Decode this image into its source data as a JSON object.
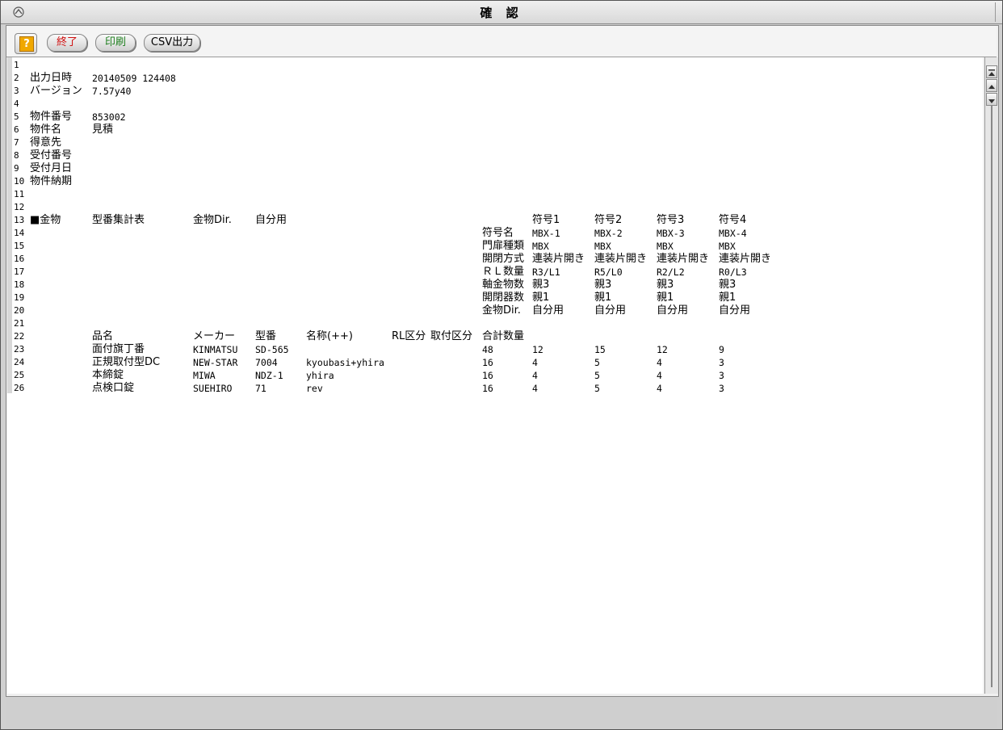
{
  "window": {
    "title": "確 認"
  },
  "toolbar": {
    "help_label": "?",
    "exit_label": "終了",
    "print_label": "印刷",
    "csv_label": "CSV出力",
    "exit_color": "#d01010",
    "print_color": "#208020"
  },
  "report": {
    "line_numbers": [
      "1",
      "2",
      "3",
      "4",
      "5",
      "6",
      "7",
      "8",
      "9",
      "10",
      "11",
      "12",
      "13",
      "14",
      "15",
      "16",
      "17",
      "18",
      "19",
      "20",
      "21",
      "22",
      "23",
      "24",
      "25",
      "26"
    ],
    "header": {
      "output_datetime_label": "出力日時",
      "output_datetime_value": "20140509 124408",
      "version_label": "バージョン",
      "version_value": "7.57y40",
      "property_no_label": "物件番号",
      "property_no_value": "853002",
      "property_name_label": "物件名",
      "property_name_value": "見積",
      "customer_label": "得意先",
      "reception_no_label": "受付番号",
      "reception_date_label": "受付月日",
      "delivery_label": "物件納期"
    },
    "section": {
      "hardware_label": "■金物",
      "model_summary_label": "型番集計表",
      "hardware_dir_label": "金物Dir.",
      "hardware_dir_value": "自分用"
    },
    "symbols": {
      "row_labels": [
        "符号名",
        "門扉種類",
        "開閉方式",
        "ＲＬ数量",
        "軸金物数",
        "開閉器数",
        "金物Dir."
      ],
      "columns": [
        {
          "header": "符号1",
          "values": [
            "MBX-1",
            "MBX",
            "連装片開き",
            "R3/L1",
            "親3",
            "親1",
            "自分用"
          ]
        },
        {
          "header": "符号2",
          "values": [
            "MBX-2",
            "MBX",
            "連装片開き",
            "R5/L0",
            "親3",
            "親1",
            "自分用"
          ]
        },
        {
          "header": "符号3",
          "values": [
            "MBX-3",
            "MBX",
            "連装片開き",
            "R2/L2",
            "親3",
            "親1",
            "自分用"
          ]
        },
        {
          "header": "符号4",
          "values": [
            "MBX-4",
            "MBX",
            "連装片開き",
            "R0/L3",
            "親3",
            "親1",
            "自分用"
          ]
        }
      ]
    },
    "table": {
      "headers": [
        "品名",
        "メーカー",
        "型番",
        "名称(++)",
        "RL区分",
        "取付区分",
        "合計数量"
      ],
      "rows": [
        {
          "name": "面付旗丁番",
          "maker": "KINMATSU",
          "model": "SD-565",
          "desc": "",
          "total": "48",
          "q": [
            "12",
            "15",
            "12",
            "9"
          ]
        },
        {
          "name": "正規取付型DC",
          "maker": "NEW-STAR",
          "model": "7004",
          "desc": "kyoubasi+yhira",
          "total": "16",
          "q": [
            "4",
            "5",
            "4",
            "3"
          ]
        },
        {
          "name": "本締錠",
          "maker": "MIWA",
          "model": "NDZ-1",
          "desc": "yhira",
          "total": "16",
          "q": [
            "4",
            "5",
            "4",
            "3"
          ]
        },
        {
          "name": "点検口錠",
          "maker": "SUEHIRO",
          "model": "71",
          "desc": "rev",
          "total": "16",
          "q": [
            "4",
            "5",
            "4",
            "3"
          ]
        }
      ]
    }
  }
}
